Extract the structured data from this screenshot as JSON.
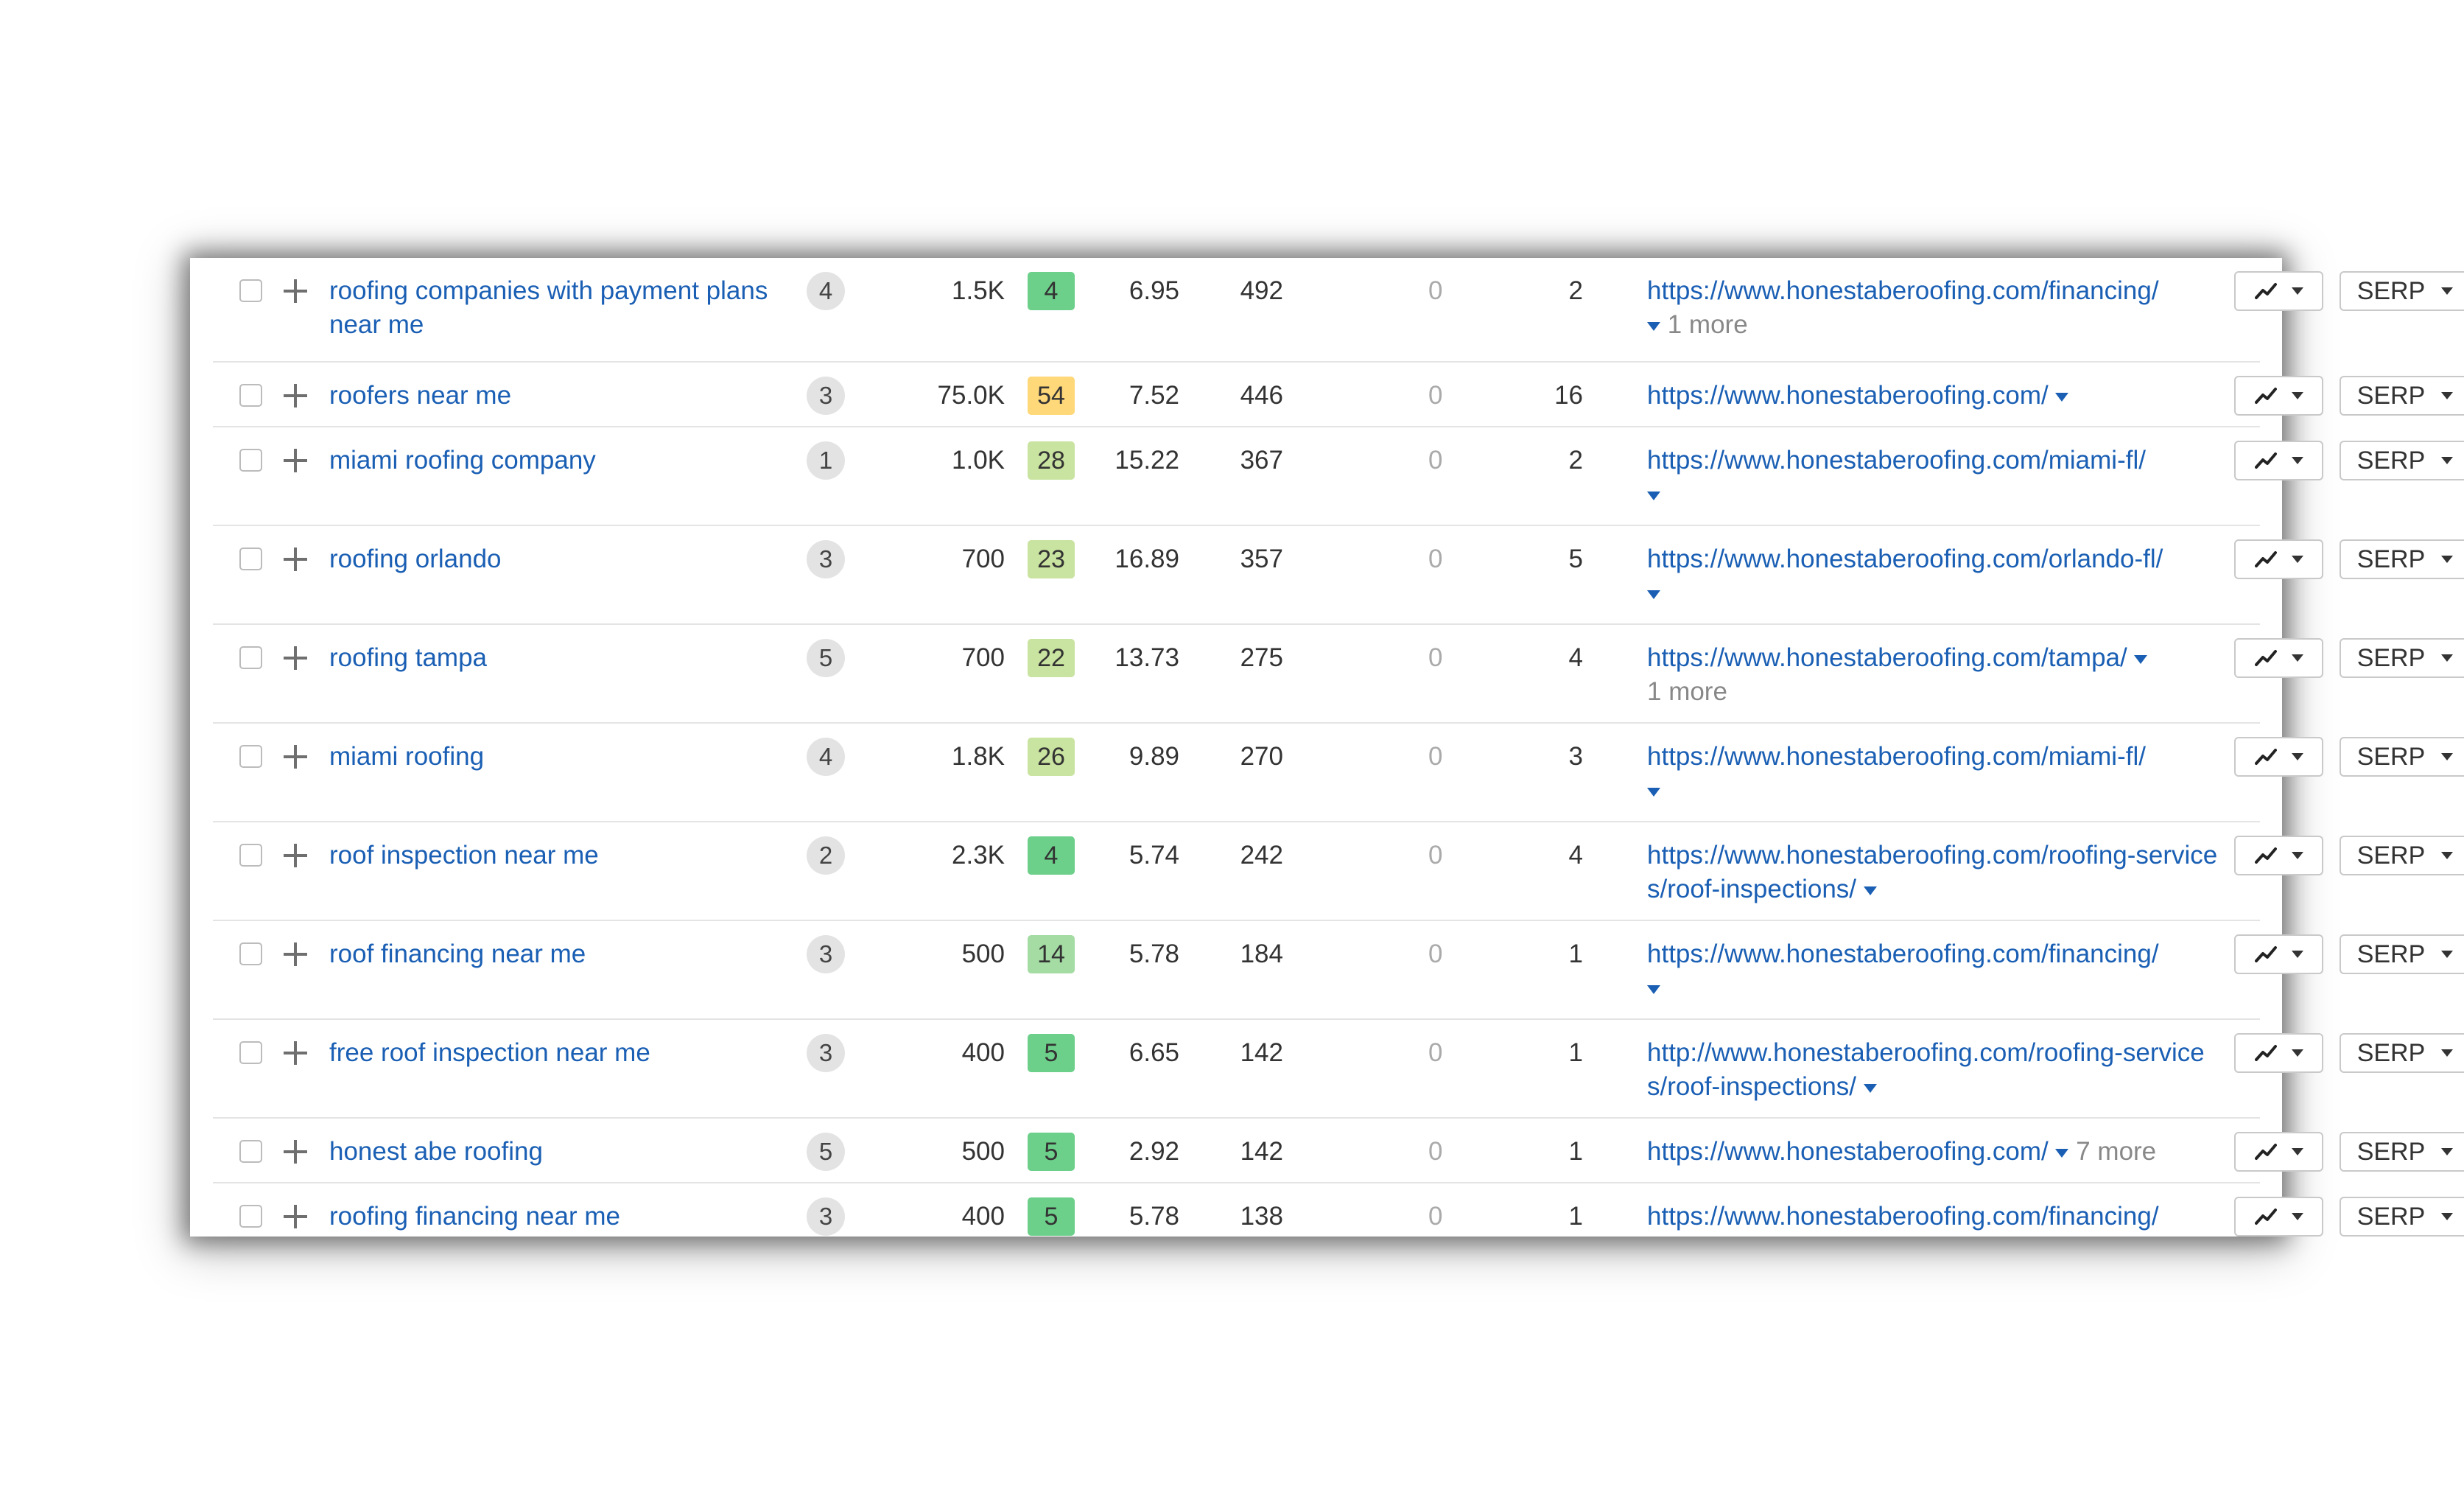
{
  "table": {
    "serp_label": "SERP",
    "rows": [
      {
        "keyword": "roofing companies with payment plans near me",
        "position": "4",
        "volume": "1.5K",
        "kd": "4",
        "kd_color": "#6ccf8a",
        "cpc": "6.95",
        "traffic": "492",
        "zero": "0",
        "count": "2",
        "url": "https://www.honestaberoofing.com/financing/",
        "more": "1 more"
      },
      {
        "keyword": "roofers near me",
        "position": "3",
        "volume": "75.0K",
        "kd": "54",
        "kd_color": "#ffd87a",
        "cpc": "7.52",
        "traffic": "446",
        "zero": "0",
        "count": "16",
        "url": "https://www.honestaberoofing.com/",
        "more": ""
      },
      {
        "keyword": "miami roofing company",
        "position": "1",
        "volume": "1.0K",
        "kd": "28",
        "kd_color": "#c9e3a0",
        "cpc": "15.22",
        "traffic": "367",
        "zero": "0",
        "count": "2",
        "url": "https://www.honestaberoofing.com/miami-fl/",
        "more": ""
      },
      {
        "keyword": "roofing orlando",
        "position": "3",
        "volume": "700",
        "kd": "23",
        "kd_color": "#c9e3a0",
        "cpc": "16.89",
        "traffic": "357",
        "zero": "0",
        "count": "5",
        "url": "https://www.honestaberoofing.com/orlando-fl/",
        "more": ""
      },
      {
        "keyword": "roofing tampa",
        "position": "5",
        "volume": "700",
        "kd": "22",
        "kd_color": "#c9e3a0",
        "cpc": "13.73",
        "traffic": "275",
        "zero": "0",
        "count": "4",
        "url": "https://www.honestaberoofing.com/tampa/",
        "more": "1 more"
      },
      {
        "keyword": "miami roofing",
        "position": "4",
        "volume": "1.8K",
        "kd": "26",
        "kd_color": "#c9e3a0",
        "cpc": "9.89",
        "traffic": "270",
        "zero": "0",
        "count": "3",
        "url": "https://www.honestaberoofing.com/miami-fl/",
        "more": ""
      },
      {
        "keyword": "roof inspection near me",
        "position": "2",
        "volume": "2.3K",
        "kd": "4",
        "kd_color": "#6ccf8a",
        "cpc": "5.74",
        "traffic": "242",
        "zero": "0",
        "count": "4",
        "url": "https://www.honestaberoofing.com/roofing-services/roof-inspections/",
        "more": ""
      },
      {
        "keyword": "roof financing near me",
        "position": "3",
        "volume": "500",
        "kd": "14",
        "kd_color": "#a4dca4",
        "cpc": "5.78",
        "traffic": "184",
        "zero": "0",
        "count": "1",
        "url": "https://www.honestaberoofing.com/financing/",
        "more": ""
      },
      {
        "keyword": "free roof inspection near me",
        "position": "3",
        "volume": "400",
        "kd": "5",
        "kd_color": "#6ccf8a",
        "cpc": "6.65",
        "traffic": "142",
        "zero": "0",
        "count": "1",
        "url": "http://www.honestaberoofing.com/roofing-services/roof-inspections/",
        "more": ""
      },
      {
        "keyword": "honest abe roofing",
        "position": "5",
        "volume": "500",
        "kd": "5",
        "kd_color": "#6ccf8a",
        "cpc": "2.92",
        "traffic": "142",
        "zero": "0",
        "count": "1",
        "url": "https://www.honestaberoofing.com/",
        "more": "7 more"
      },
      {
        "keyword": "roofing financing near me",
        "position": "3",
        "volume": "400",
        "kd": "5",
        "kd_color": "#6ccf8a",
        "cpc": "5.78",
        "traffic": "138",
        "zero": "0",
        "count": "1",
        "url": "https://www.honestaberoofing.com/financing/",
        "more": ""
      }
    ]
  }
}
